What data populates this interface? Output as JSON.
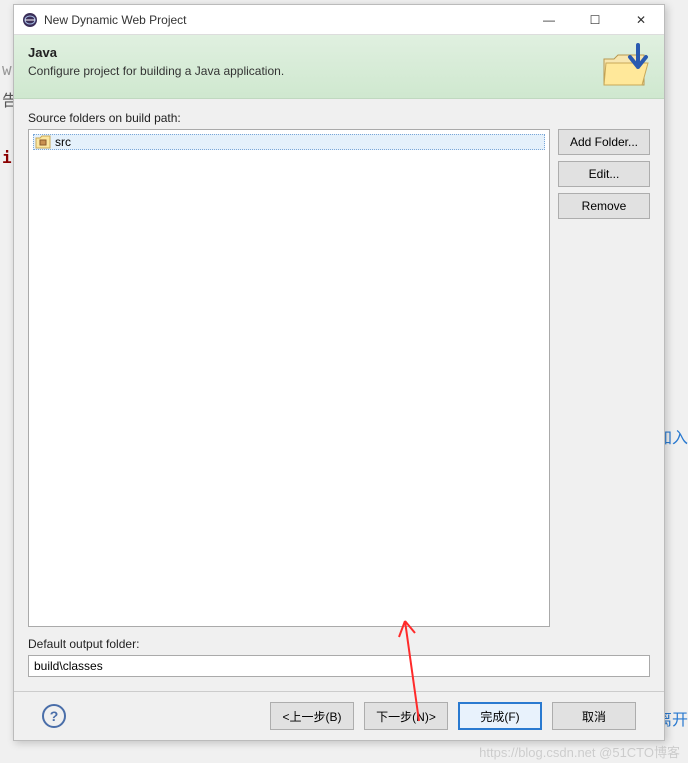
{
  "titlebar": {
    "title": "New Dynamic Web Project"
  },
  "banner": {
    "heading": "Java",
    "subtitle": "Configure project for building a Java application."
  },
  "sourceFolders": {
    "label": "Source folders on build path:",
    "items": [
      {
        "label": "src"
      }
    ],
    "buttons": {
      "add": "Add Folder...",
      "edit": "Edit...",
      "remove": "Remove"
    }
  },
  "output": {
    "label": "Default output folder:",
    "value": "build\\classes"
  },
  "footer": {
    "back": "<上一步(B)",
    "next": "下一步(N)>",
    "finish": "完成(F)",
    "cancel": "取消"
  },
  "help": "?",
  "winbuttons": {
    "min": "—",
    "max": "☐",
    "close": "✕"
  },
  "watermark": "https://blog.csdn.net @51CTO博客",
  "bg": {
    "link1": "加入",
    "link2": "离开"
  }
}
